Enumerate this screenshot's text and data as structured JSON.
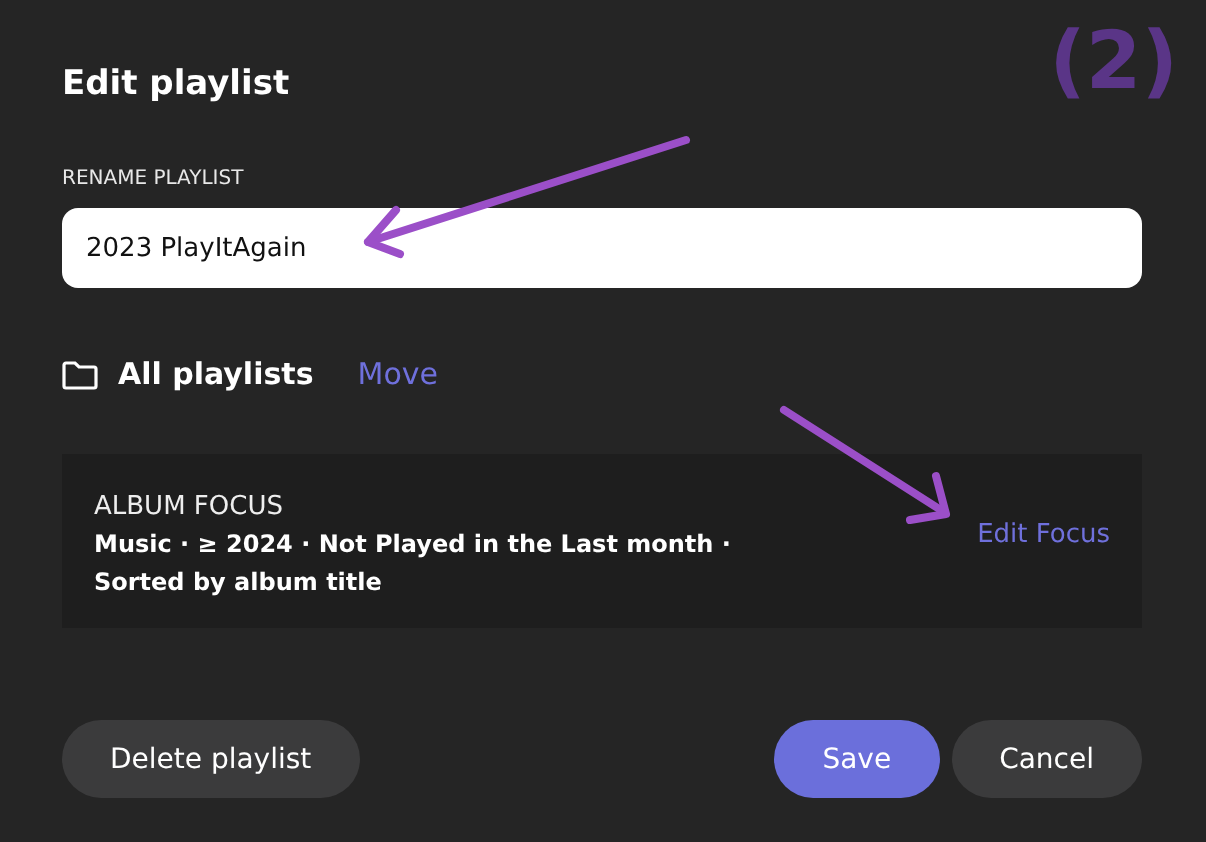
{
  "dialog": {
    "title": "Edit playlist",
    "rename": {
      "label": "RENAME PLAYLIST",
      "value": "2023 PlayItAgain"
    },
    "location": {
      "folder": "All playlists",
      "action": "Move"
    },
    "focus": {
      "heading": "ALBUM FOCUS",
      "description": "Music · ≥ 2024 · Not Played in the Last month · Sorted by album title",
      "action": "Edit Focus"
    },
    "buttons": [
      {
        "label": "Delete playlist",
        "kind": "secondary"
      },
      {
        "label": "Save",
        "kind": "primary"
      },
      {
        "label": "Cancel",
        "kind": "secondary"
      }
    ]
  },
  "annotation": {
    "label": "(2)"
  }
}
